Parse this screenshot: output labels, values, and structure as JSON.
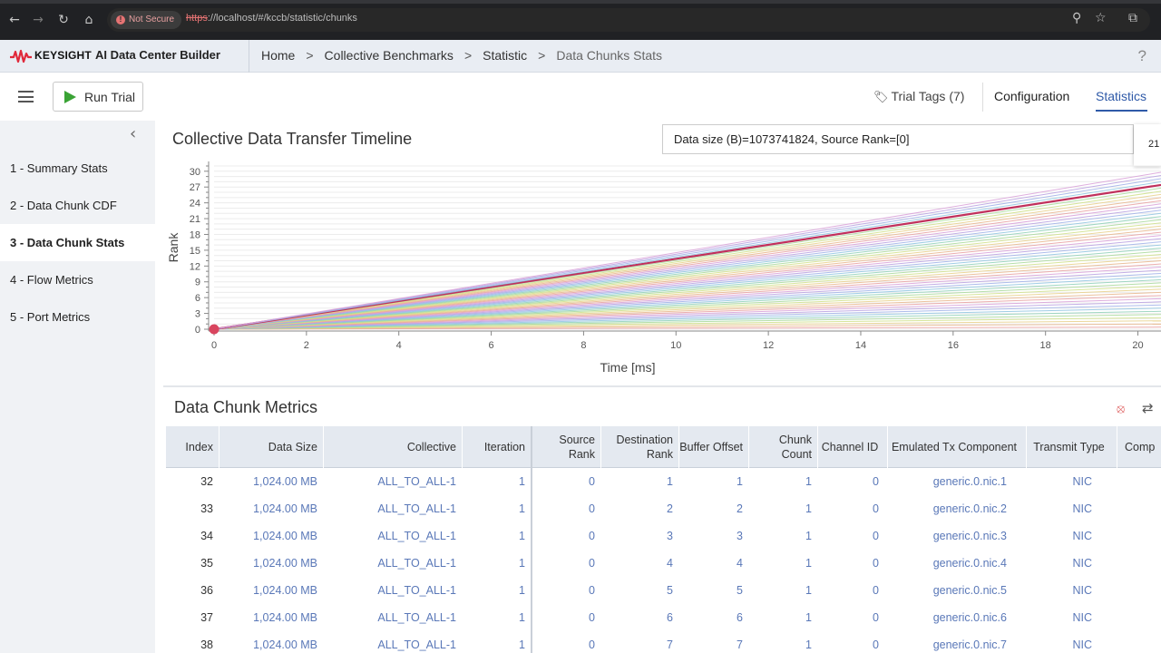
{
  "browser": {
    "not_secure": "Not Secure",
    "url_scheme": "https",
    "url_rest": "://localhost/#/kccb/statistic/chunks",
    "back_icon": "back-arrow-icon",
    "forward_icon": "forward-arrow-icon",
    "reload_icon": "reload-icon",
    "home_icon": "home-icon"
  },
  "header": {
    "brand": "KEYSIGHT",
    "app_name": "AI Data Center Builder",
    "breadcrumb": [
      "Home",
      "Collective Benchmarks",
      "Statistic",
      "Data Chunks Stats"
    ],
    "help": "?"
  },
  "toolbar": {
    "run_trial": "Run Trial",
    "trial_tags": "Trial Tags (7)",
    "configuration": "Configuration",
    "statistics": "Statistics"
  },
  "sidebar": {
    "items": [
      {
        "label": "1 - Summary Stats"
      },
      {
        "label": "2 - Data Chunk CDF"
      },
      {
        "label": "3 - Data Chunk Stats"
      },
      {
        "label": "4 - Flow Metrics"
      },
      {
        "label": "5 - Port Metrics"
      }
    ],
    "active_index": 2
  },
  "chart": {
    "title": "Collective Data Transfer Timeline",
    "info": "Data size (B)=1073741824, Source Rank=[0]",
    "tooltip": "21"
  },
  "chart_data": {
    "type": "line",
    "title": "Collective Data Transfer Timeline",
    "xlabel": "Time [ms]",
    "ylabel": "Rank",
    "xlim": [
      0,
      20.5
    ],
    "ylim": [
      0,
      31
    ],
    "x_ticks": [
      0,
      2,
      4,
      6,
      8,
      10,
      12,
      14,
      16,
      18,
      20
    ],
    "y_ticks": [
      0,
      3,
      6,
      9,
      12,
      15,
      18,
      21,
      24,
      27,
      30
    ],
    "grid": true,
    "series_start": {
      "x": 0,
      "y": 0
    },
    "series_end_x": 20.5,
    "series_end_y": [
      0.4,
      1.0,
      1.6,
      2.2,
      2.8,
      3.4,
      4.0,
      4.6,
      5.2,
      5.8,
      6.4,
      7.0,
      7.6,
      8.2,
      8.8,
      9.4,
      10.0,
      10.6,
      11.2,
      11.8,
      12.4,
      13.0,
      13.6,
      14.2,
      14.8,
      15.4,
      16.0,
      16.6,
      17.2,
      17.8,
      18.4,
      19.0,
      19.6,
      20.2,
      20.8,
      21.4,
      22.0,
      22.6,
      23.2,
      23.8,
      24.4,
      25.0,
      25.6,
      26.2,
      26.8,
      27.4,
      28.0,
      28.6,
      29.2,
      29.8
    ],
    "highlight_series_index": 45,
    "series_colors": [
      "#e8a0a0",
      "#e8b68c",
      "#e8d08a",
      "#cfe08a",
      "#a8d89a",
      "#8fd0b8",
      "#8fc4e0",
      "#9fb0e8",
      "#b8a0e0",
      "#d8a0d8"
    ],
    "highlight_color": "#c0305c",
    "start_marker_color": "#d9455f"
  },
  "table": {
    "title": "Data Chunk Metrics",
    "filter_icon": "filter-clear-icon",
    "swap_icon": "swap-icon",
    "columns": [
      "Index",
      "Data Size",
      "Collective",
      "Iteration",
      "Source Rank",
      "Destination Rank",
      "Buffer Offset",
      "Chunk Count",
      "Channel ID",
      "Emulated Tx Component",
      "Transmit Type",
      "Comp"
    ],
    "rows": [
      [
        "32",
        "1,024.00 MB",
        "ALL_TO_ALL-1",
        "1",
        "0",
        "1",
        "1",
        "1",
        "0",
        "generic.0.nic.1",
        "NIC"
      ],
      [
        "33",
        "1,024.00 MB",
        "ALL_TO_ALL-1",
        "1",
        "0",
        "2",
        "2",
        "1",
        "0",
        "generic.0.nic.2",
        "NIC"
      ],
      [
        "34",
        "1,024.00 MB",
        "ALL_TO_ALL-1",
        "1",
        "0",
        "3",
        "3",
        "1",
        "0",
        "generic.0.nic.3",
        "NIC"
      ],
      [
        "35",
        "1,024.00 MB",
        "ALL_TO_ALL-1",
        "1",
        "0",
        "4",
        "4",
        "1",
        "0",
        "generic.0.nic.4",
        "NIC"
      ],
      [
        "36",
        "1,024.00 MB",
        "ALL_TO_ALL-1",
        "1",
        "0",
        "5",
        "5",
        "1",
        "0",
        "generic.0.nic.5",
        "NIC"
      ],
      [
        "37",
        "1,024.00 MB",
        "ALL_TO_ALL-1",
        "1",
        "0",
        "6",
        "6",
        "1",
        "0",
        "generic.0.nic.6",
        "NIC"
      ],
      [
        "38",
        "1,024.00 MB",
        "ALL_TO_ALL-1",
        "1",
        "0",
        "7",
        "7",
        "1",
        "0",
        "generic.0.nic.7",
        "NIC"
      ]
    ]
  }
}
